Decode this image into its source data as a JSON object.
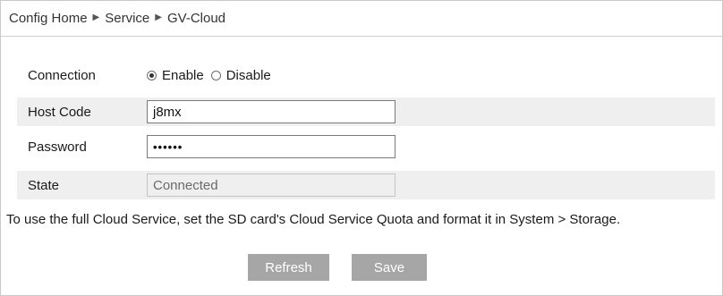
{
  "breadcrumb": {
    "items": [
      "Config Home",
      "Service",
      "GV-Cloud"
    ],
    "separator": "▶"
  },
  "form": {
    "connection": {
      "label": "Connection",
      "options": [
        {
          "label": "Enable",
          "selected": true
        },
        {
          "label": "Disable",
          "selected": false
        }
      ]
    },
    "host_code": {
      "label": "Host Code",
      "value": "j8mx"
    },
    "password": {
      "label": "Password",
      "value": "••••••"
    },
    "state": {
      "label": "State",
      "value": "Connected"
    }
  },
  "note": "To use the full Cloud Service, set the SD card's Cloud Service Quota and format it in System > Storage.",
  "buttons": {
    "refresh": "Refresh",
    "save": "Save"
  },
  "colors": {
    "row_shade": "#efefef",
    "button_bg": "#a6a6a6",
    "button_text": "#ffffff"
  }
}
